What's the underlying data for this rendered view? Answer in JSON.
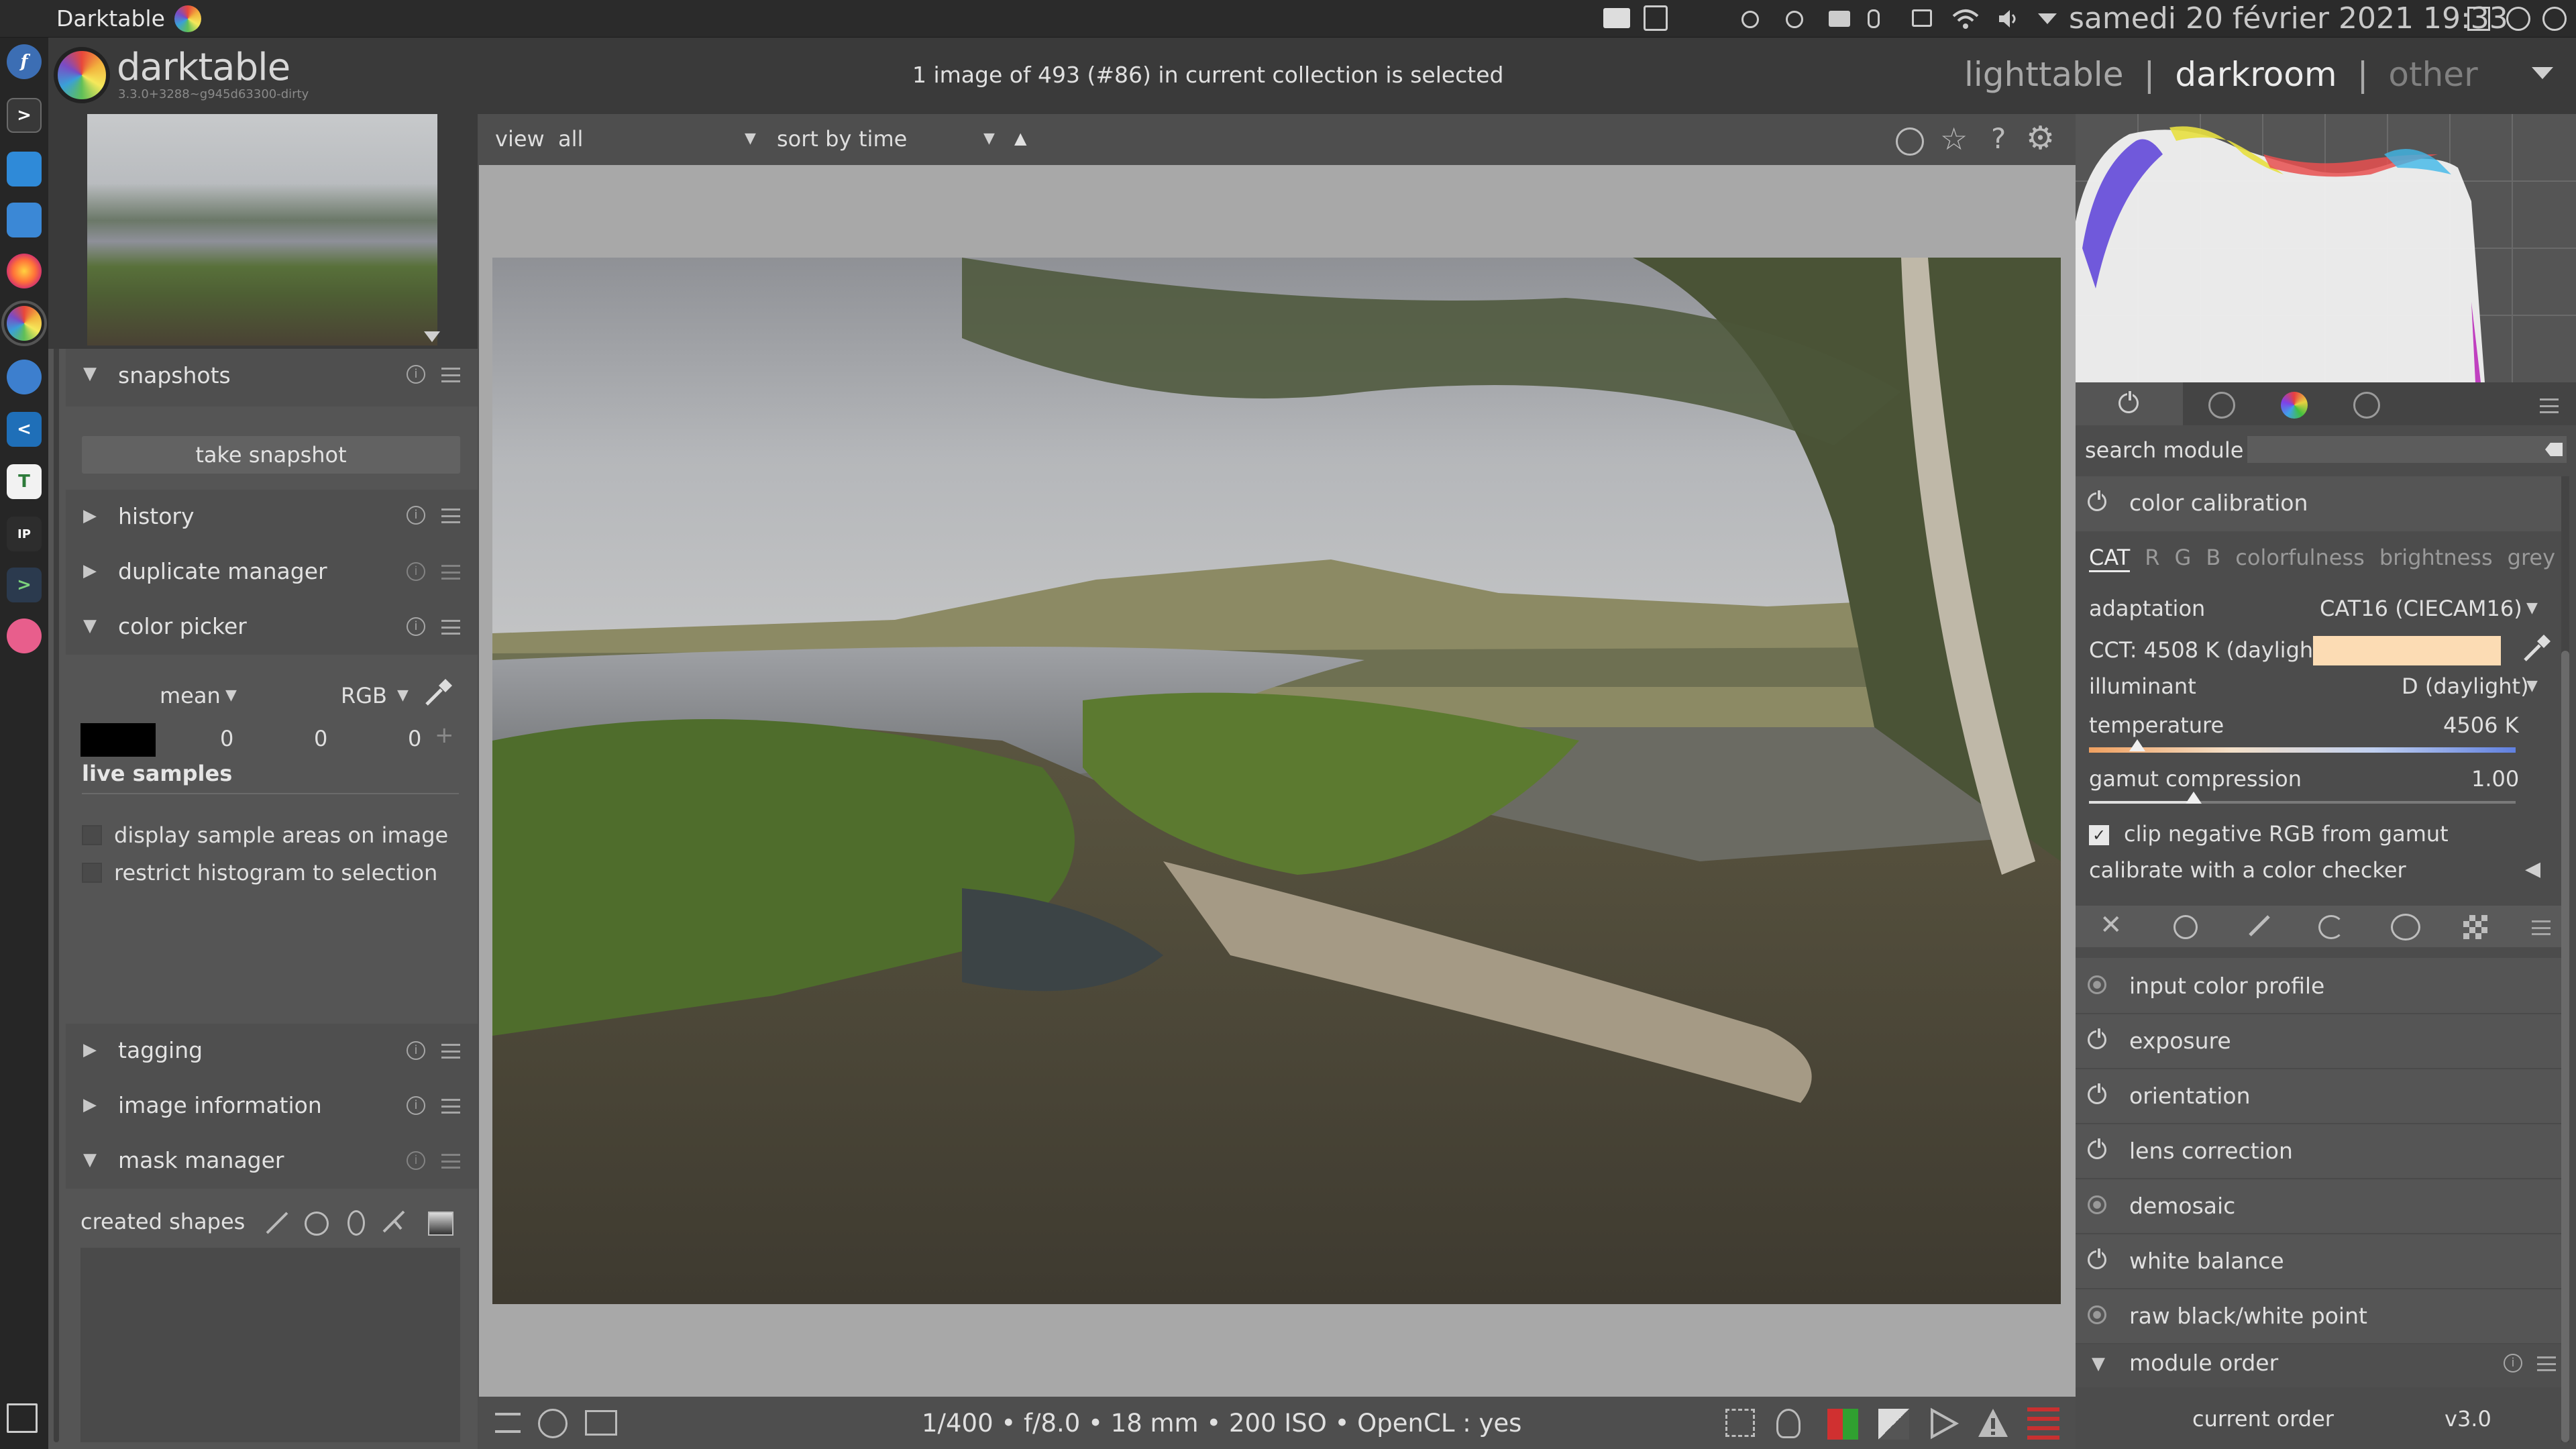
{
  "topbar": {
    "app_name": "Darktable",
    "clock": "samedi 20 février 2021 19:33"
  },
  "header": {
    "brand": "darktable",
    "version": "3.3.0+3288~g945d63300-dirty",
    "status": "1 image of 493 (#86) in current collection is selected",
    "views": [
      "lighttable",
      "darkroom",
      "other"
    ],
    "active_view": "darkroom",
    "separator": "|"
  },
  "left": {
    "snapshots": {
      "title": "snapshots",
      "button": "take snapshot"
    },
    "history": {
      "title": "history"
    },
    "duplicate": {
      "title": "duplicate manager"
    },
    "color_picker": {
      "title": "color picker",
      "mode": "mean",
      "space": "RGB",
      "values": [
        "0",
        "0",
        "0"
      ],
      "live_samples": "live samples",
      "opt1": "display sample areas on image",
      "opt2": "restrict histogram to selection"
    },
    "tagging": {
      "title": "tagging"
    },
    "image_info": {
      "title": "image information"
    },
    "mask_manager": {
      "title": "mask manager",
      "created_shapes": "created shapes"
    }
  },
  "center": {
    "view_label": "view",
    "view_value": "all",
    "sort_label": "sort by",
    "sort_value": "time",
    "exif": "1/400 • f/8.0 • 18 mm • 200 ISO • OpenCL : yes"
  },
  "right": {
    "search_label": "search module",
    "color_calibration": {
      "title": "color calibration",
      "tabs": [
        "CAT",
        "R",
        "G",
        "B",
        "colorfulness",
        "brightness",
        "grey"
      ],
      "adaptation_label": "adaptation",
      "adaptation_value": "CAT16 (CIECAM16)",
      "cct": "CCT: 4508 K (daylight)",
      "cct_swatch": "#fcdcb4",
      "illuminant_label": "illuminant",
      "illuminant_value": "D (daylight)",
      "temperature_label": "temperature",
      "temperature_value": "4506 K",
      "gamut_label": "gamut compression",
      "gamut_value": "1.00",
      "clip_label": "clip negative RGB from gamut",
      "calibrate_label": "calibrate with a color checker"
    },
    "modules": [
      "input color profile",
      "exposure",
      "orientation",
      "lens correction",
      "demosaic",
      "white balance",
      "raw black/white point"
    ],
    "module_order": {
      "title": "module order",
      "label": "current order",
      "value": "v3.0"
    }
  }
}
